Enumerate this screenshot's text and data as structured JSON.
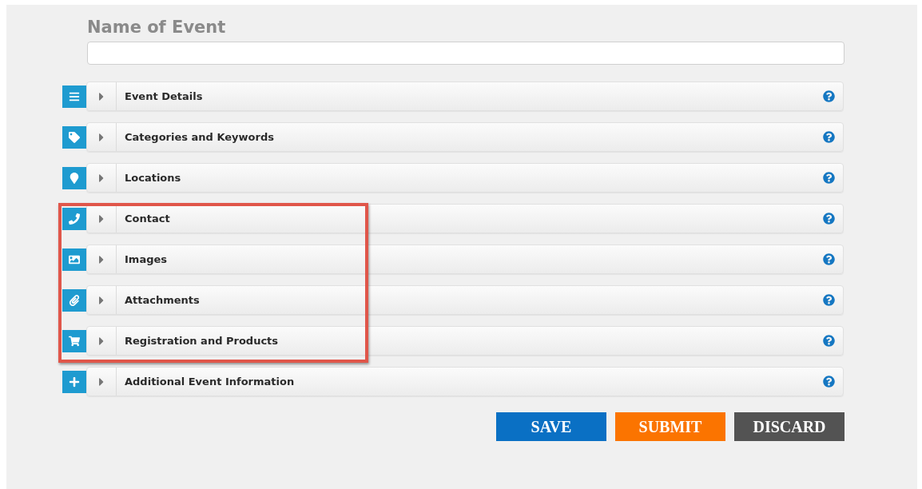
{
  "title": "Name of Event",
  "sections": [
    {
      "label": "Event Details",
      "kind": "list",
      "expanded": false,
      "highlighted": false
    },
    {
      "label": "Categories and Keywords",
      "kind": "tag",
      "expanded": false,
      "highlighted": false
    },
    {
      "label": "Locations",
      "kind": "pin",
      "expanded": false,
      "highlighted": false
    },
    {
      "label": "Contact",
      "kind": "phone",
      "expanded": false,
      "highlighted": true
    },
    {
      "label": "Images",
      "kind": "image",
      "expanded": false,
      "highlighted": true
    },
    {
      "label": "Attachments",
      "kind": "paperclip",
      "expanded": false,
      "highlighted": true
    },
    {
      "label": "Registration and Products",
      "kind": "cart",
      "expanded": false,
      "highlighted": true
    },
    {
      "label": "Additional Event Information",
      "kind": "plus",
      "expanded": false,
      "highlighted": false
    }
  ],
  "buttons": [
    {
      "label": "SAVE",
      "kind": "save"
    },
    {
      "label": "SUBMIT",
      "kind": "submit"
    },
    {
      "label": "DISCARD",
      "kind": "discard"
    }
  ]
}
